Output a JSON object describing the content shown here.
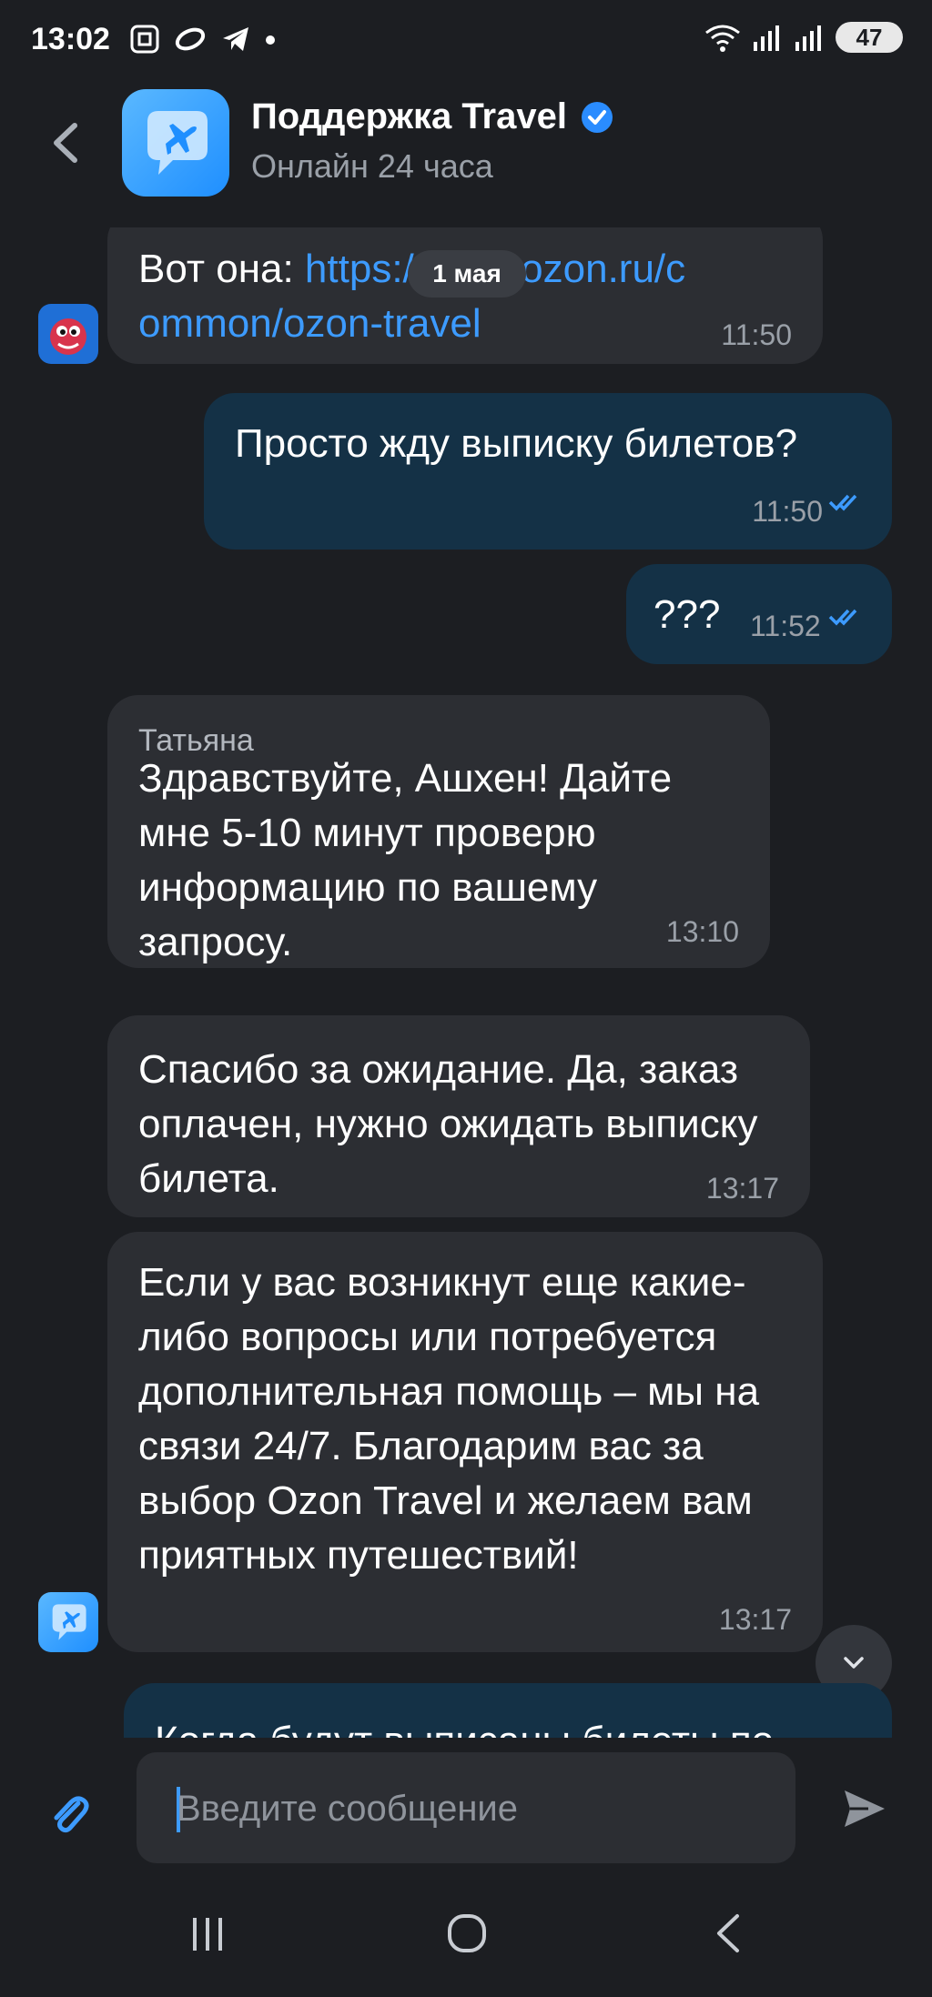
{
  "status_bar": {
    "time": "13:02",
    "battery": "47"
  },
  "header": {
    "title": "Поддержка Travel",
    "subtitle": "Онлайн 24 часа"
  },
  "date_chip": "1 мая",
  "messages": [
    {
      "type": "incoming",
      "text_prefix": "Вот она: ",
      "link": "https://docs.ozon.ru/common/ozon-travel",
      "time": "11:50"
    },
    {
      "type": "outgoing",
      "text": "Просто жду выписку билетов?",
      "time": "11:50"
    },
    {
      "type": "outgoing",
      "text": "???",
      "time": "11:52"
    },
    {
      "type": "incoming",
      "sender": "Татьяна",
      "text": "Здравствуйте, Ашхен! Дайте мне 5-10 минут проверю информацию по вашему запросу.",
      "time": "13:10"
    },
    {
      "type": "incoming",
      "text": "Спасибо за ожидание. Да, заказ оплачен, нужно ожидать выписку билета.",
      "time": "13:17"
    },
    {
      "type": "incoming",
      "text": "Если у вас возникнут еще какие-либо вопросы или потребуется дополнительная помощь – мы на связи 24/7. Благодарим вас за выбор Ozon Travel и желаем вам приятных путешествий!",
      "time": "13:17"
    },
    {
      "type": "outgoing",
      "text": "Когда будут выписаны билеты по"
    }
  ],
  "input": {
    "placeholder": "Введите сообщение"
  },
  "colors": {
    "accent": "#3d9bff",
    "incoming_bubble": "#2c2e33",
    "outgoing_bubble": "#143146",
    "background": "#1c1e22"
  }
}
